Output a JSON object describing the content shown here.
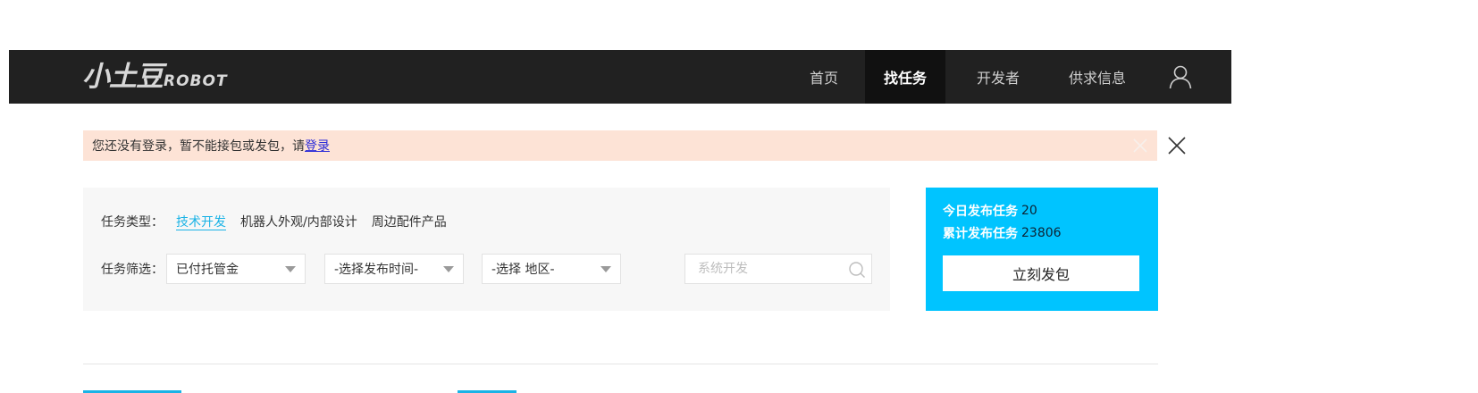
{
  "header": {
    "logo_cn": "小土豆",
    "logo_en": "ROBOT",
    "nav": [
      {
        "label": "首页",
        "active": false
      },
      {
        "label": "找任务",
        "active": true
      },
      {
        "label": "开发者",
        "active": false
      },
      {
        "label": "供求信息",
        "active": false
      }
    ],
    "user_icon": "user-icon"
  },
  "notice": {
    "text": "您还没有登录，暂不能接包或发包，请",
    "link": "登录",
    "close_icon": "close-icon"
  },
  "filter": {
    "type_label": "任务类型：",
    "types": [
      "技术开发",
      "机器人外观/内部设计",
      "周边配件产品"
    ],
    "active_type": "技术开发",
    "filter_label": "任务筛选：",
    "select_payment": "已付托管金",
    "select_time": "-选择发布时间-",
    "select_region": "-选择 地区-",
    "search_placeholder": "系统开发",
    "search_icon": "search-icon"
  },
  "stats": {
    "today_label": "今日发布任务",
    "today_value": "20",
    "total_label": "累计发布任务",
    "total_value": "23806",
    "publish_button": "立刻发包"
  },
  "colors": {
    "header_bg": "#212121",
    "nav_active_bg": "#111111",
    "notice_bg": "#fde3d6",
    "accent": "#00c4ff",
    "link": "#1ab3e6",
    "filter_bg": "#f7f7f7"
  }
}
